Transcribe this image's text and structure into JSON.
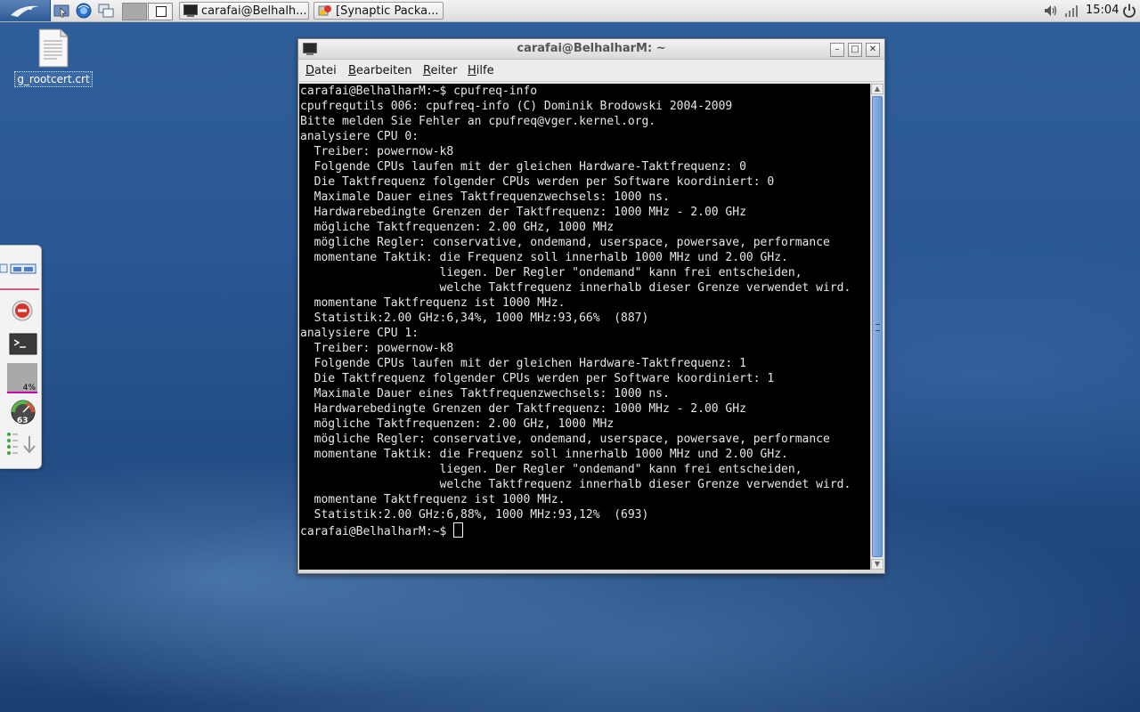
{
  "panel": {
    "tasks": [
      {
        "label": "carafai@Belhalh...",
        "icon": "terminal-icon"
      },
      {
        "label": "[Synaptic Packa...",
        "icon": "synaptic-icon"
      }
    ],
    "clock": "15:04",
    "tray_icons": [
      "volume-icon",
      "power-icon"
    ]
  },
  "desktop": {
    "icons": [
      {
        "label": "g_rootcert.crt",
        "icon": "file-icon"
      }
    ]
  },
  "dock": {
    "cpu_label": "4%",
    "gauge_label": "63",
    "icons": [
      "window-list-icon",
      "stop-icon",
      "terminal-icon",
      "cpu-graph-icon",
      "speed-gauge-icon",
      "list-arrow-icon"
    ]
  },
  "window": {
    "title": "carafai@BelhalharM: ~",
    "menu": [
      {
        "label": "Datei",
        "accel": "D",
        "rest": "atei"
      },
      {
        "label": "Bearbeiten",
        "accel": "B",
        "rest": "earbeiten"
      },
      {
        "label": "Reiter",
        "accel": "R",
        "rest": "eiter"
      },
      {
        "label": "Hilfe",
        "accel": "H",
        "rest": "ilfe"
      }
    ],
    "terminal": {
      "lines": [
        "carafai@BelhalharM:~$ cpufreq-info",
        "cpufrequtils 006: cpufreq-info (C) Dominik Brodowski 2004-2009",
        "Bitte melden Sie Fehler an cpufreq@vger.kernel.org.",
        "analysiere CPU 0:",
        "  Treiber: powernow-k8",
        "  Folgende CPUs laufen mit der gleichen Hardware-Taktfrequenz: 0",
        "  Die Taktfrequenz folgender CPUs werden per Software koordiniert: 0",
        "  Maximale Dauer eines Taktfrequenzwechsels: 1000 ns.",
        "  Hardwarebedingte Grenzen der Taktfrequenz: 1000 MHz - 2.00 GHz",
        "  mögliche Taktfrequenzen: 2.00 GHz, 1000 MHz",
        "  mögliche Regler: conservative, ondemand, userspace, powersave, performance",
        "  momentane Taktik: die Frequenz soll innerhalb 1000 MHz und 2.00 GHz.",
        "                    liegen. Der Regler \"ondemand\" kann frei entscheiden,",
        "                    welche Taktfrequenz innerhalb dieser Grenze verwendet wird.",
        "  momentane Taktfrequenz ist 1000 MHz.",
        "  Statistik:2.00 GHz:6,34%, 1000 MHz:93,66%  (887)",
        "analysiere CPU 1:",
        "  Treiber: powernow-k8",
        "  Folgende CPUs laufen mit der gleichen Hardware-Taktfrequenz: 1",
        "  Die Taktfrequenz folgender CPUs werden per Software koordiniert: 1",
        "  Maximale Dauer eines Taktfrequenzwechsels: 1000 ns.",
        "  Hardwarebedingte Grenzen der Taktfrequenz: 1000 MHz - 2.00 GHz",
        "  mögliche Taktfrequenzen: 2.00 GHz, 1000 MHz",
        "  mögliche Regler: conservative, ondemand, userspace, powersave, performance",
        "  momentane Taktik: die Frequenz soll innerhalb 1000 MHz und 2.00 GHz.",
        "                    liegen. Der Regler \"ondemand\" kann frei entscheiden,",
        "                    welche Taktfrequenz innerhalb dieser Grenze verwendet wird.",
        "  momentane Taktfrequenz ist 1000 MHz.",
        "  Statistik:2.00 GHz:6,88%, 1000 MHz:93,12%  (693)"
      ],
      "prompt": "carafai@BelhalharM:~$ "
    }
  }
}
